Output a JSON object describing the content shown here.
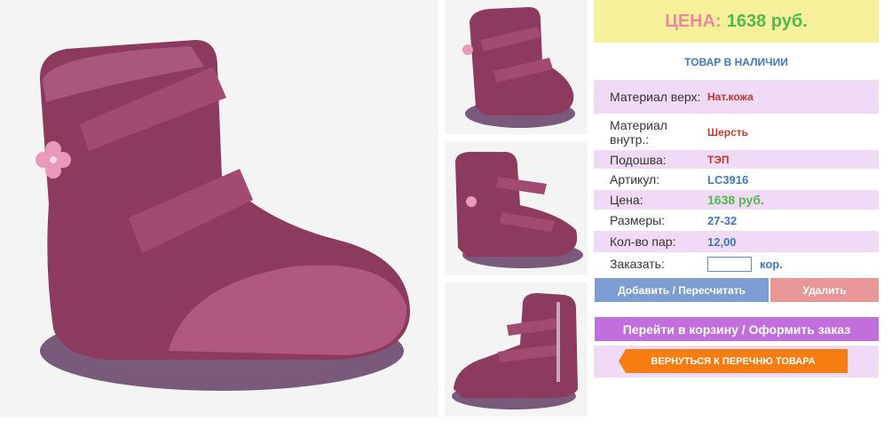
{
  "price": {
    "label": "ЦЕНА:",
    "value": "1638 руб."
  },
  "stock_status": "ТОВАР В НАЛИЧИИ",
  "specs": [
    {
      "key": "Материал верх:",
      "value": "Нат.кожа"
    },
    {
      "key": "Материал внутр.:",
      "value": "Шерсть"
    },
    {
      "key": "Подошва:",
      "value": "ТЭП"
    },
    {
      "key": "Артикул:",
      "value": "LC3916"
    },
    {
      "key": "Цена:",
      "value": "1638 руб."
    },
    {
      "key": "Размеры:",
      "value": "27-32"
    },
    {
      "key": "Кол-во пар:",
      "value": "12,00"
    }
  ],
  "order": {
    "label": "Заказать:",
    "unit": "кор.",
    "quantity": ""
  },
  "buttons": {
    "add": "Добавить / Пересчитать",
    "delete": "Удалить",
    "cart": "Перейти в корзину / Оформить заказ",
    "back": "ВЕРНУТЬСЯ К ПЕРЕЧНЮ ТОВАРА"
  },
  "colors": {
    "boot": "#8c3a5e",
    "price_bg": "#f6f09a",
    "accent_green": "#53b84e",
    "accent_blue": "#3f77c1",
    "row_pink": "#f1daf5",
    "cart_purple": "#c06fdc",
    "back_orange": "#f57d12"
  },
  "images": {
    "main": "boot-side-view-photo",
    "thumbnails": [
      "boot-front-view-photo",
      "boot-angle-view-photo",
      "boot-inner-side-photo"
    ]
  }
}
